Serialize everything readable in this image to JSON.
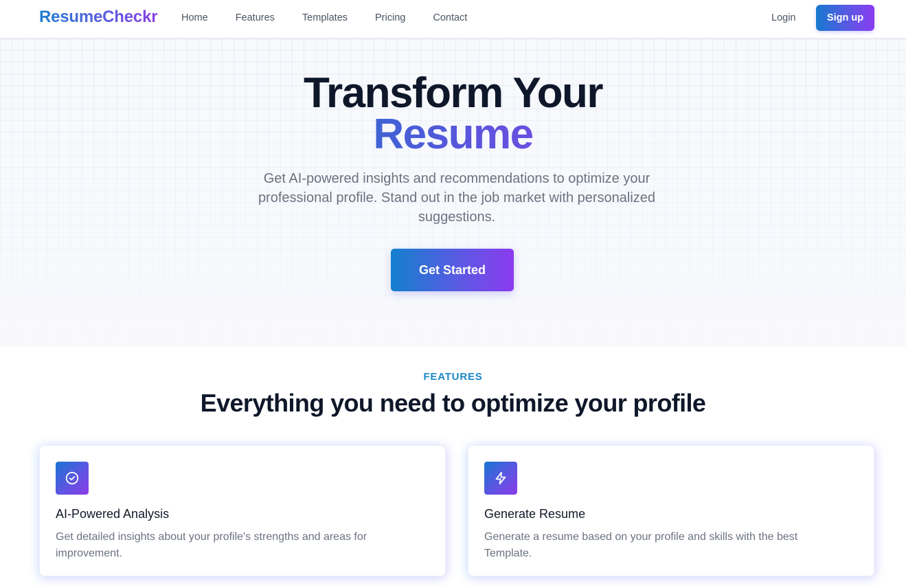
{
  "navbar": {
    "logo": "ResumeCheckr",
    "links": [
      {
        "label": "Home"
      },
      {
        "label": "Features"
      },
      {
        "label": "Templates"
      },
      {
        "label": "Pricing"
      },
      {
        "label": "Contact"
      }
    ],
    "login_label": "Login",
    "signup_label": "Sign up"
  },
  "hero": {
    "title_line1": "Transform Your",
    "title_line2": "Resume",
    "subtitle": "Get AI-powered insights and recommendations to optimize your professional profile. Stand out in the job market with personalized suggestions.",
    "cta_label": "Get Started"
  },
  "features": {
    "eyebrow": "FEATURES",
    "heading": "Everything you need to optimize your profile",
    "cards": [
      {
        "icon": "check-circle-icon",
        "title": "AI-Powered Analysis",
        "description": "Get detailed insights about your profile's strengths and areas for improvement."
      },
      {
        "icon": "lightning-icon",
        "title": "Generate Resume",
        "description": "Generate a resume based on your profile and skills with the best Template."
      }
    ]
  },
  "colors": {
    "brand_gradient_start": "#1778cf",
    "brand_gradient_end": "#8a3cf0",
    "eyebrow": "#1a87c7",
    "heading": "#0f172a",
    "body_text": "#6b7280"
  }
}
